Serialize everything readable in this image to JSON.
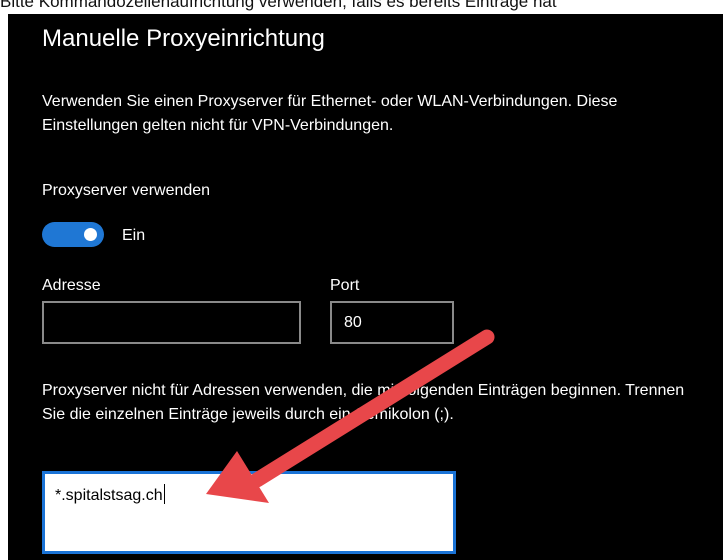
{
  "caption": "Bitte Kommandozeilenaufrichtung verwenden, falls es bereits Einträge hat",
  "panel": {
    "title": "Manuelle Proxyeinrichtung",
    "description": "Verwenden Sie einen Proxyserver für Ethernet- oder WLAN-Verbindungen. Diese Einstellungen gelten nicht für VPN-Verbindungen.",
    "use_proxy_label": "Proxyserver verwenden",
    "toggle": {
      "state_label": "Ein",
      "on": true
    },
    "address": {
      "label": "Adresse",
      "value": ""
    },
    "port": {
      "label": "Port",
      "value": "80"
    },
    "exceptions": {
      "description": "Proxyserver nicht für Adressen verwenden, die mit folgenden Einträgen beginnen. Trennen Sie die einzelnen Einträge jeweils durch ein Semikolon (;).",
      "value": "*.spitalstsag.ch"
    }
  },
  "annotation": {
    "arrow_color": "#e8474a"
  },
  "colors": {
    "toggle_on": "#1f77d4",
    "focus_border": "#1a73d6",
    "panel_bg": "#000000"
  }
}
